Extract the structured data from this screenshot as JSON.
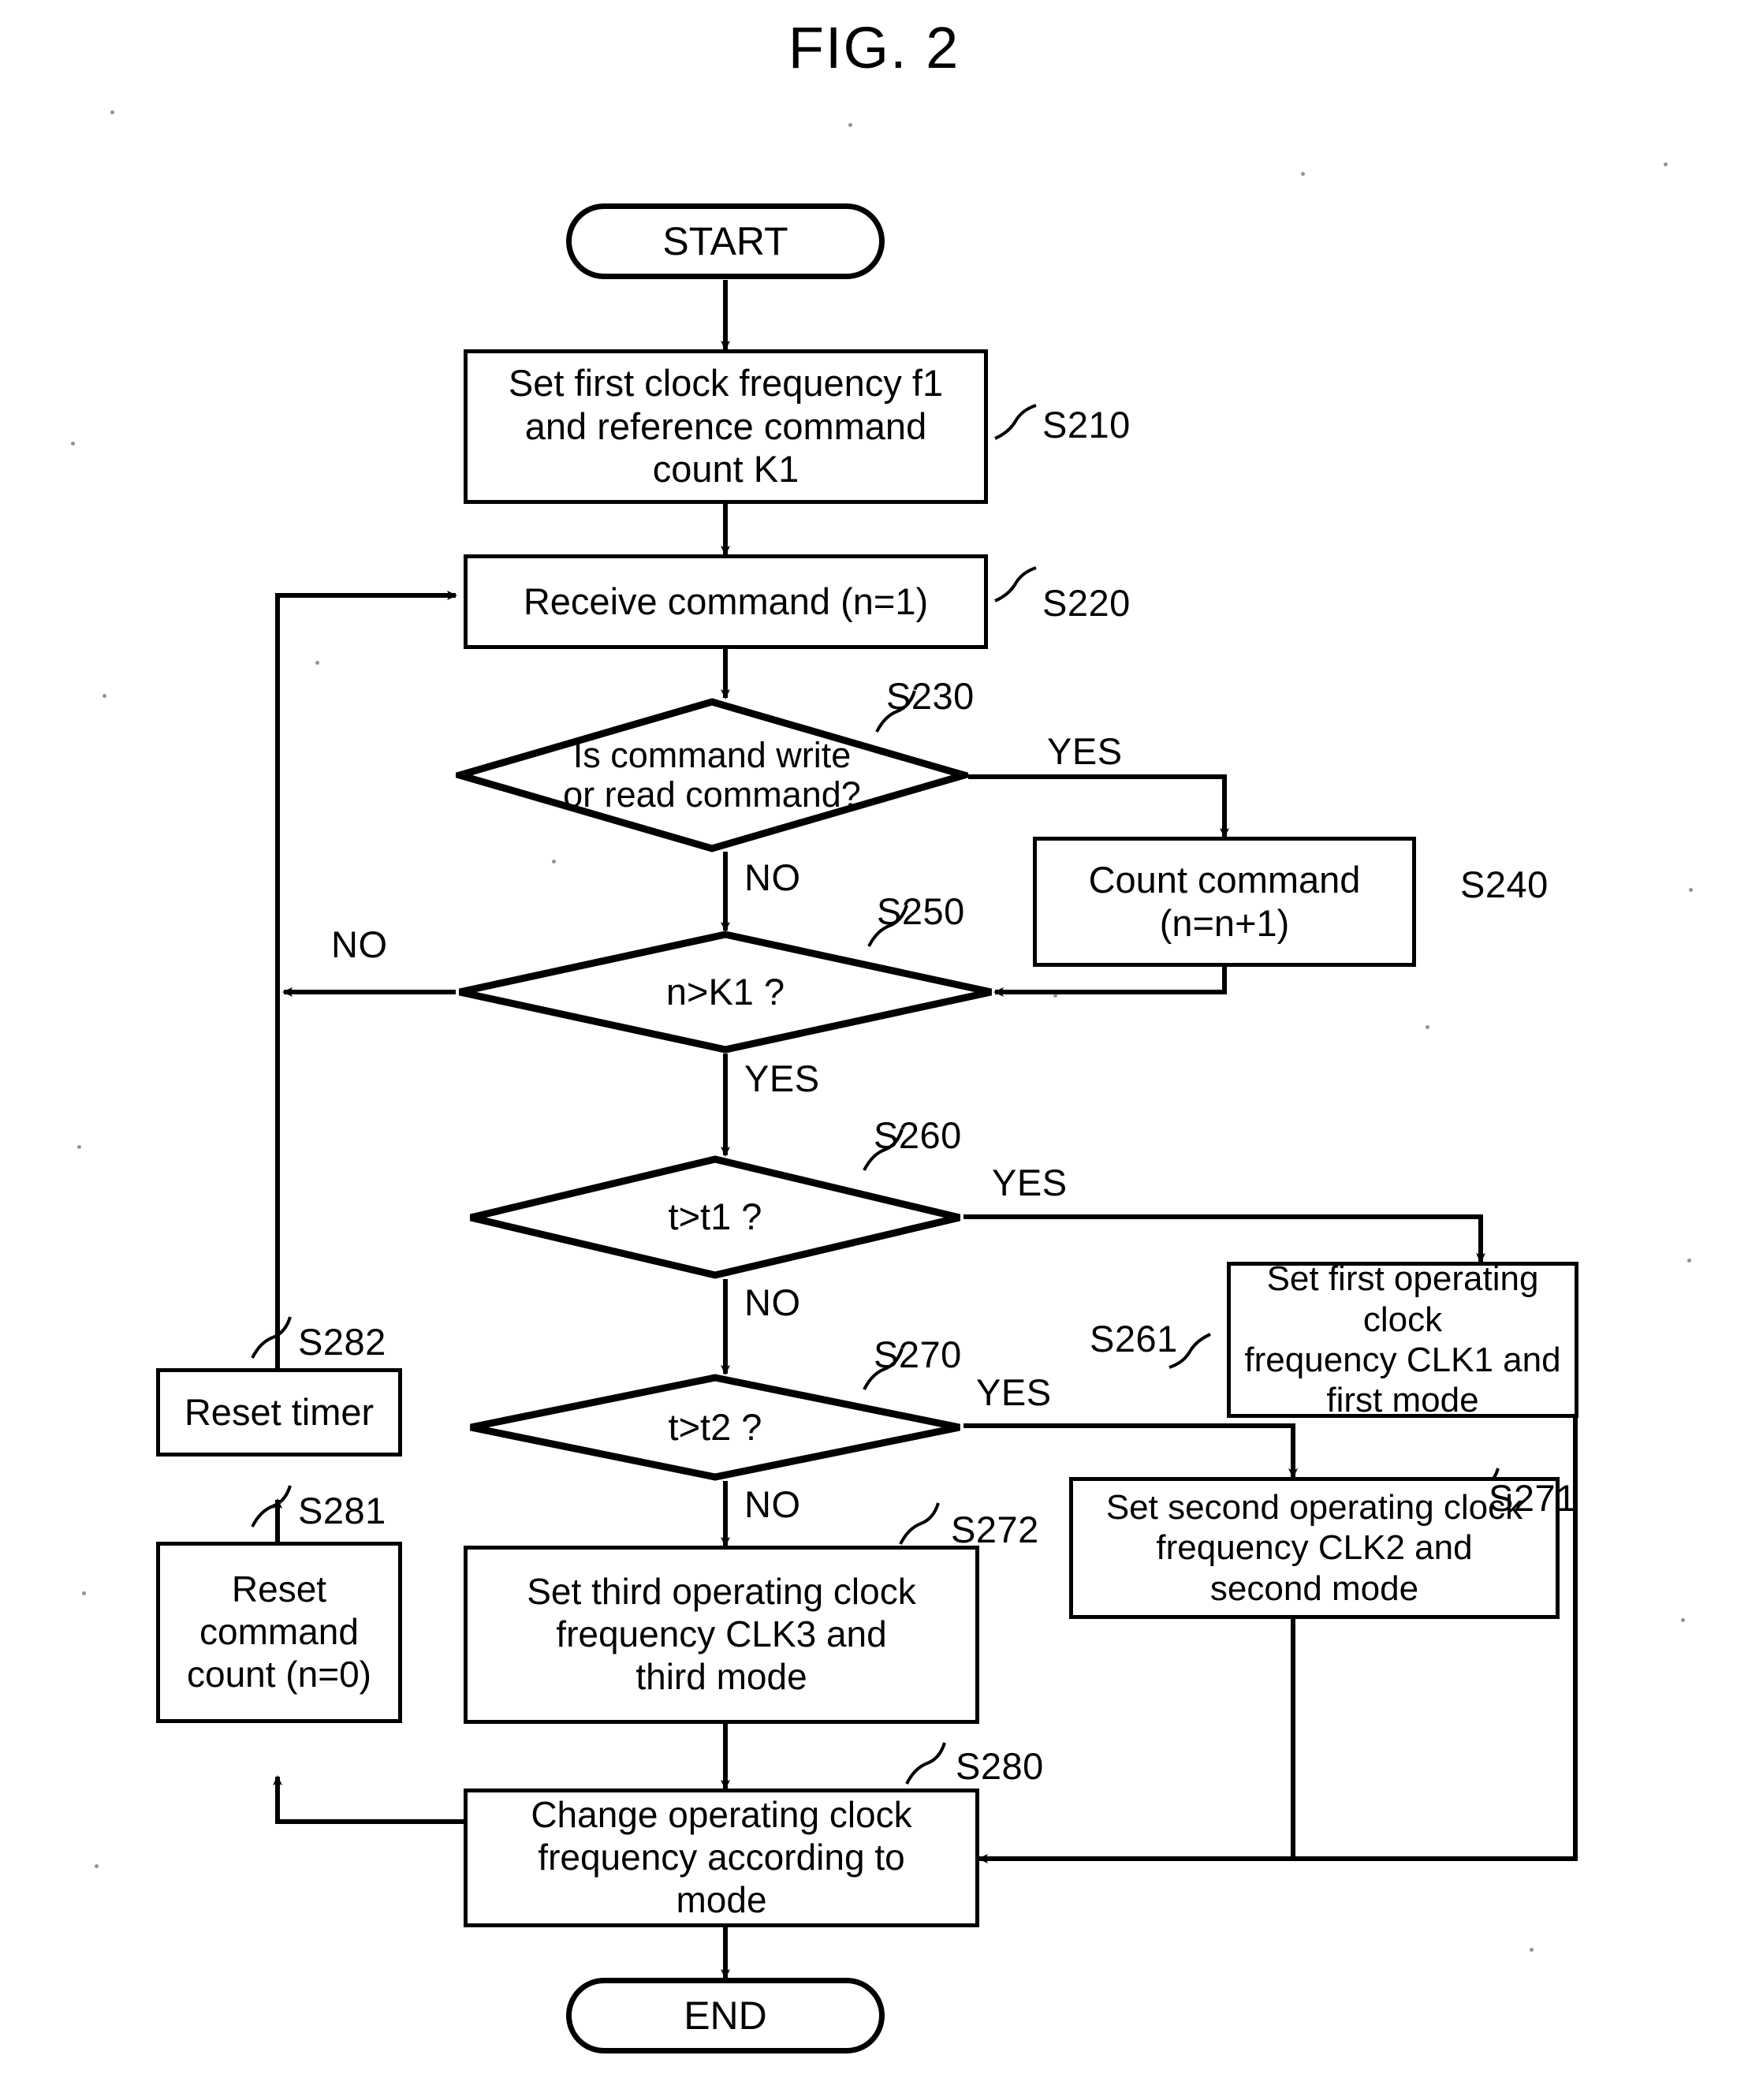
{
  "figure": {
    "title": "FIG. 2",
    "type": "flowchart"
  },
  "nodes": {
    "start": {
      "label": "START",
      "shape": "terminator"
    },
    "s210": {
      "label": "Set first clock frequency f1\nand reference command\ncount K1",
      "shape": "process",
      "tag": "S210"
    },
    "s220": {
      "label": "Receive command (n=1)",
      "shape": "process",
      "tag": "S220"
    },
    "s230": {
      "label": "Is command write\nor read command?",
      "shape": "decision",
      "tag": "S230"
    },
    "s240": {
      "label": "Count command\n(n=n+1)",
      "shape": "process",
      "tag": "S240"
    },
    "s250": {
      "label": "n>K1 ?",
      "shape": "decision",
      "tag": "S250"
    },
    "s260": {
      "label": "t>t1 ?",
      "shape": "decision",
      "tag": "S260"
    },
    "s261": {
      "label": "Set first operating clock\nfrequency CLK1 and\nfirst mode",
      "shape": "process",
      "tag": "S261"
    },
    "s270": {
      "label": "t>t2 ?",
      "shape": "decision",
      "tag": "S270"
    },
    "s271": {
      "label": "Set second operating clock\nfrequency CLK2 and\nsecond mode",
      "shape": "process",
      "tag": "S271"
    },
    "s272": {
      "label": "Set third operating clock\nfrequency CLK3 and\nthird mode",
      "shape": "process",
      "tag": "S272"
    },
    "s280": {
      "label": "Change operating clock\nfrequency according to\nmode",
      "shape": "process",
      "tag": "S280"
    },
    "s281": {
      "label": "Reset\ncommand\ncount (n=0)",
      "shape": "process",
      "tag": "S281"
    },
    "s282": {
      "label": "Reset timer",
      "shape": "process",
      "tag": "S282"
    },
    "end": {
      "label": "END",
      "shape": "terminator"
    }
  },
  "edge_labels": {
    "s230_yes": "YES",
    "s230_no": "NO",
    "s250_no": "NO",
    "s250_yes": "YES",
    "s260_yes": "YES",
    "s260_no": "NO",
    "s270_yes": "YES",
    "s270_no": "NO"
  },
  "colors": {
    "ink": "#000000",
    "paper": "#ffffff"
  }
}
